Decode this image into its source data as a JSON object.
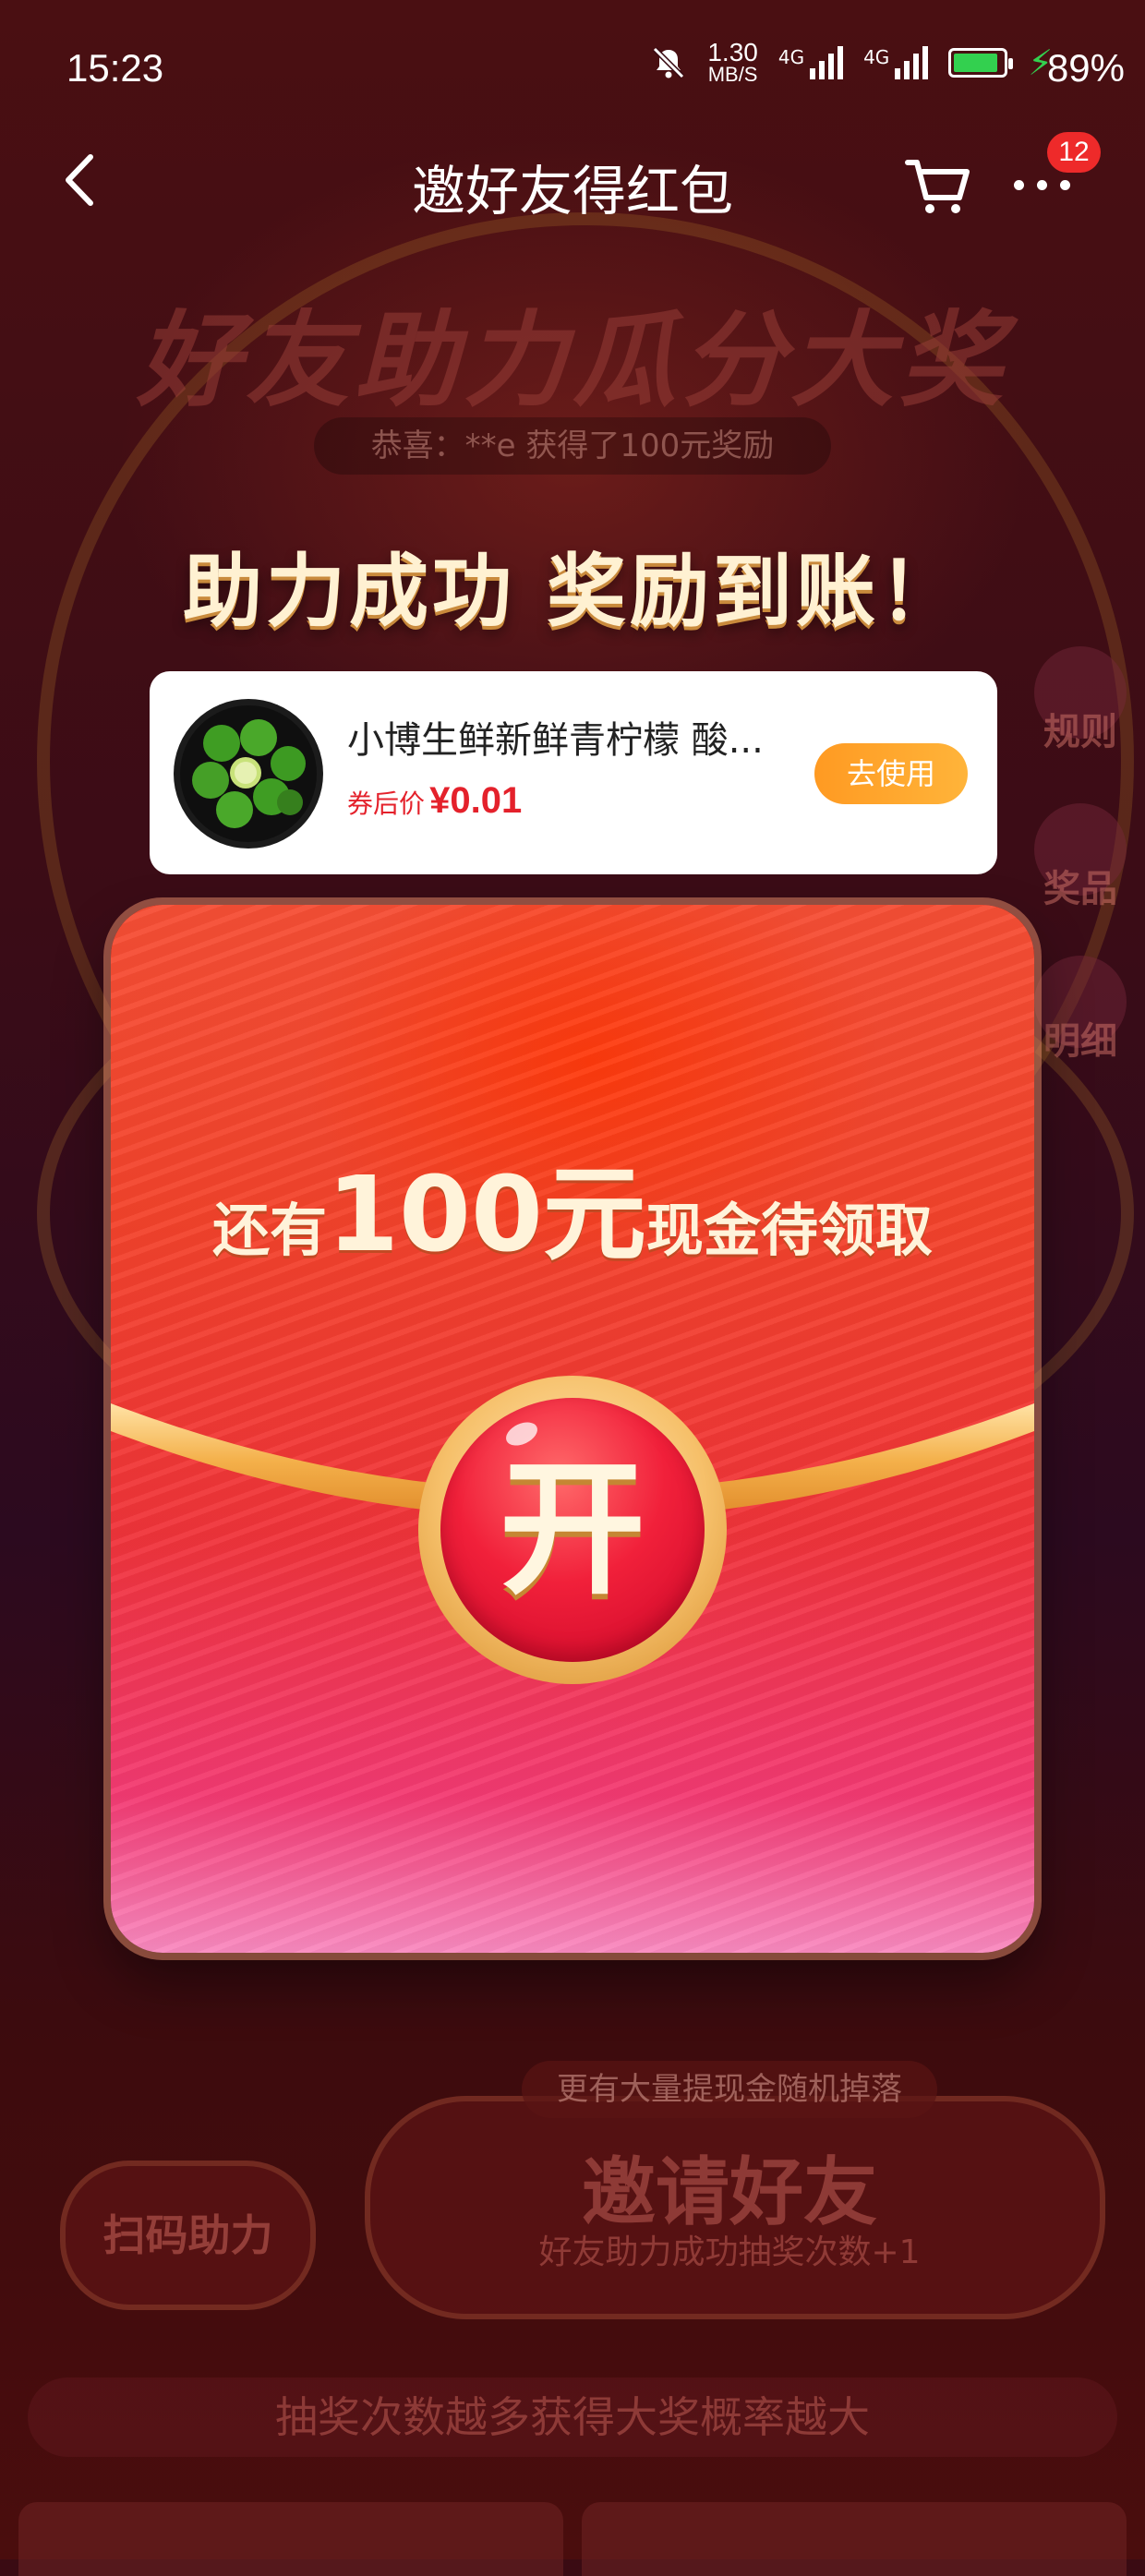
{
  "status_bar": {
    "time": "15:23",
    "net_speed_value": "1.30",
    "net_speed_unit": "MB/S",
    "sim1_label": "4G",
    "sim2_label": "4G",
    "battery_percent": "89%",
    "battery_level": 0.89,
    "battery_color": "#33d04f"
  },
  "nav": {
    "title": "邀好友得红包",
    "badge_count": "12"
  },
  "background": {
    "banner_title": "好友助力瓜分大奖",
    "marquee": "恭喜：**e 获得了100元奖励",
    "side_buttons": [
      "规则",
      "奖品",
      "明细"
    ],
    "bottom_tag": "更有大量提现金随机掉落",
    "invite_button": "邀请好友",
    "invite_sub": "好友助力成功抽奖次数+1",
    "scan_button": "扫码助力",
    "tip_strip": "抽奖次数越多获得大奖概率越大"
  },
  "popup": {
    "success_title": "助力成功 奖励到账！",
    "product": {
      "name": "小博生鲜新鲜青柠檬 酸...",
      "price_label": "券后价",
      "price": "¥0.01",
      "use_button": "去使用"
    },
    "envelope": {
      "claim_prefix": "还有",
      "claim_amount": "100元",
      "claim_suffix": "现金待领取",
      "open_button": "开"
    }
  }
}
